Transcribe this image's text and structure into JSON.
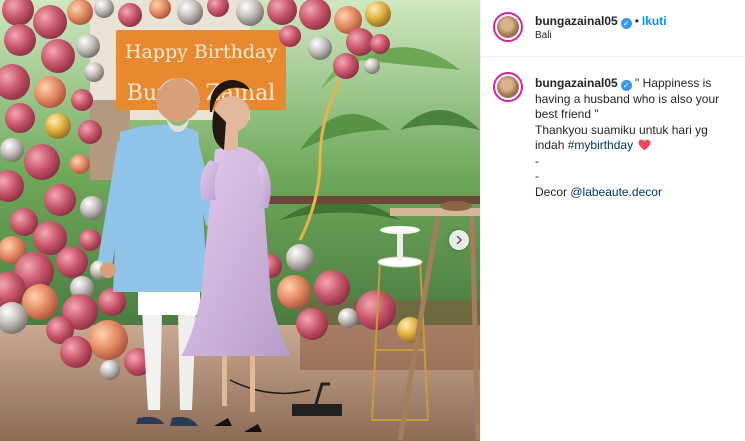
{
  "post": {
    "username": "bungazainal05",
    "location": "Bali",
    "follow_label": "Ikuti",
    "follow_separator": "•",
    "verified_mark": "✓",
    "caption": {
      "line1": "\" Happiness is having a husband who is also your best friend \"",
      "line2": "Thankyou suamiku untuk hari yg indah",
      "hashtag": "#mybirthday",
      "heart_emoji": "red-heart",
      "dash1": "-",
      "dash2": "-",
      "decor_prefix": "Decor",
      "decor_mention": "@labeaute.decor"
    }
  },
  "photo": {
    "banner_line1": "Happy Birthday",
    "banner_line2": "Bunga Zainal",
    "next_icon": "chevron-right-icon"
  },
  "colors": {
    "accent_blue": "#0095f6",
    "verified_blue": "#3897f0",
    "story_ring": "#d6249f",
    "heart_red": "#ed4956",
    "banner_orange": "#e8892f",
    "balloon_rose": "#c8566a"
  }
}
